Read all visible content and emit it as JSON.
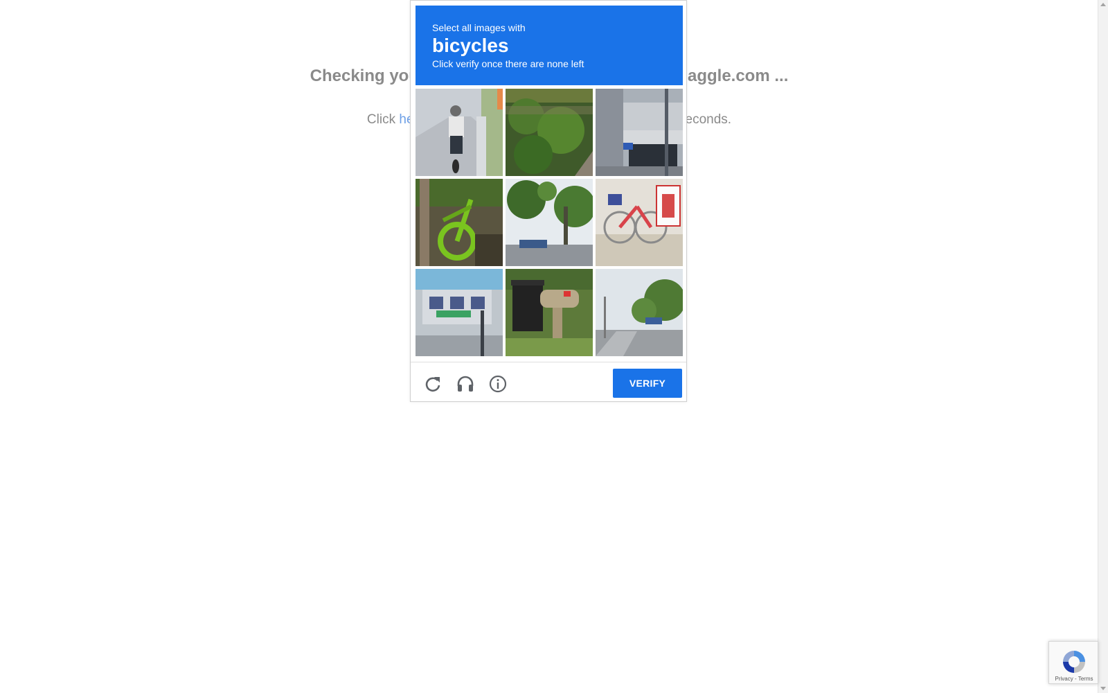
{
  "background_page": {
    "heading": "Checking you",
    "heading_tail": "aggle.com ...",
    "line_prefix": "Click ",
    "line_link": "he",
    "line_suffix": "econds."
  },
  "challenge": {
    "instruction": "Select all images with",
    "target": "bicycles",
    "subtext": "Click verify once there are none left",
    "tiles": [
      {
        "subject": "cyclist on sidewalk"
      },
      {
        "subject": "green bushes by stone wall"
      },
      {
        "subject": "building entrance with parked bikes"
      },
      {
        "subject": "green rental bike"
      },
      {
        "subject": "trees and road"
      },
      {
        "subject": "red bicycle by sign"
      },
      {
        "subject": "storefront with pedestrians"
      },
      {
        "subject": "trash bin and mailbox"
      },
      {
        "subject": "street with trees"
      }
    ],
    "footer": {
      "reload_icon": "reload-icon",
      "audio_icon": "headphones-icon",
      "info_icon": "info-icon",
      "verify_label": "VERIFY"
    }
  },
  "badge": {
    "links": "Privacy - Terms"
  },
  "colors": {
    "accent": "#1a73e8",
    "muted_text": "#8a8a8a",
    "link": "#6d9fe6"
  }
}
